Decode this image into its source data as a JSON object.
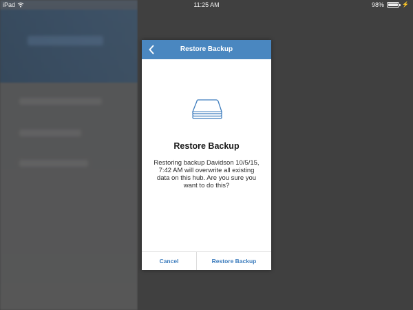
{
  "status_bar": {
    "device": "iPad",
    "time": "11:25 AM",
    "battery": "98%",
    "battery_level": 0.98,
    "wifi_icon": "wifi-icon",
    "charging_icon": "charging-bolt-icon"
  },
  "dialog": {
    "header_title": "Restore Backup",
    "back_icon": "chevron-left-icon",
    "illustration_icon": "hub-stack-icon",
    "heading": "Restore Backup",
    "message": "Restoring backup Davidson 10/5/15, 7:42 AM will overwrite all existing data on this hub. Are you sure you want to do this?",
    "cancel_label": "Cancel",
    "confirm_label": "Restore Backup"
  },
  "colors": {
    "header_blue": "#4a87c0",
    "link_blue": "#3c7cbd",
    "overlay": "#404040"
  }
}
